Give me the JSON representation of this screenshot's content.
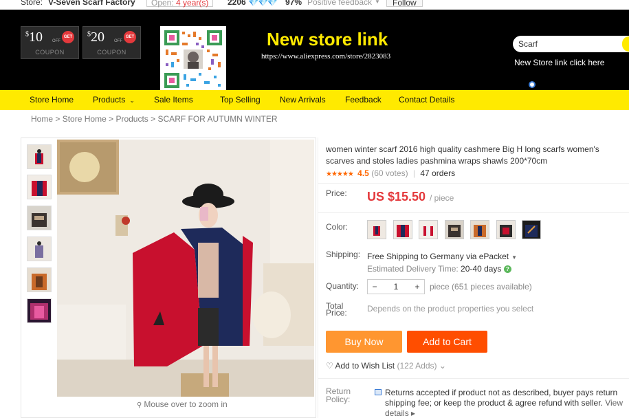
{
  "topbar": {
    "store_label": "Store:",
    "store_name": "V-Seven Scarf Factory",
    "open_label": "Open:",
    "open_years": "4 year(s)",
    "score": "2206",
    "positive_pct": "97%",
    "positive_label": "Positive feedback",
    "follow": "Follow"
  },
  "banner": {
    "coupons": [
      {
        "amount": "10",
        "currency": "$",
        "off": "OFF",
        "get": "GET",
        "label": "COUPON"
      },
      {
        "amount": "20",
        "currency": "$",
        "off": "OFF",
        "get": "GET",
        "label": "COUPON"
      }
    ],
    "title": "New store link",
    "url": "https://www.aliexpress.com/store/2823083",
    "search_value": "Scarf",
    "store_link_text": "New Store link click here"
  },
  "nav": {
    "items": [
      "Store Home",
      "Products",
      "Sale Items",
      "Top Selling",
      "New Arrivals",
      "Feedback",
      "Contact Details"
    ]
  },
  "breadcrumb": {
    "home": "Home",
    "store_home": "Store Home",
    "products": "Products",
    "current": "SCARF FOR AUTUMN WINTER",
    "sep": ">"
  },
  "gallery": {
    "zoom_hint": "Mouse over to zoom in"
  },
  "product": {
    "title": "women winter scarf 2016 high quality cashmere Big H long scarfs women's scarves and stoles ladies pashmina wraps shawls 200*70cm",
    "stars": "★★★★★",
    "rating": "4.5",
    "votes": "(60 votes)",
    "orders": "47 orders",
    "price_label": "Price:",
    "price": "US $15.50",
    "per_unit": "/ piece",
    "color_label": "Color:",
    "shipping_label": "Shipping:",
    "shipping_text": "Free Shipping to Germany via ePacket",
    "delivery_label": "Estimated Delivery Time:",
    "delivery_days": "20-40 days",
    "quantity_label": "Quantity:",
    "quantity_value": "1",
    "quantity_info": "piece (651 pieces available)",
    "total_label_1": "Total",
    "total_label_2": "Price:",
    "total_note": "Depends on the product properties you select",
    "buy_now": "Buy Now",
    "add_to_cart": "Add to Cart",
    "wishlist": "Add to Wish List",
    "wishlist_adds": "(122 Adds)",
    "return_label_1": "Return",
    "return_label_2": "Policy:",
    "return_text": "Returns accepted if product not as described, buyer pays return shipping fee; or keep the product & agree refund with seller.",
    "view_details": "View details"
  },
  "colors": {
    "nav_bg": "#ffea00",
    "price": "#e4393c",
    "buy_now": "#ff9630",
    "add_to_cart": "#ff4e00"
  }
}
